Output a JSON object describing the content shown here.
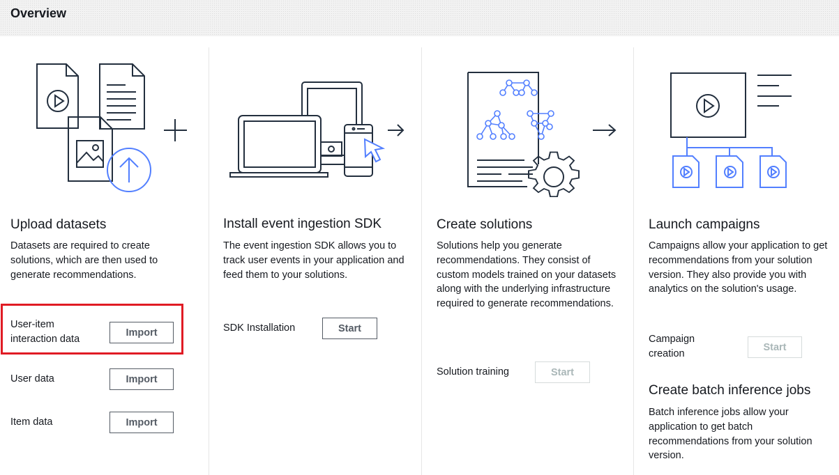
{
  "header": {
    "title": "Overview"
  },
  "columns": {
    "upload": {
      "title": "Upload datasets",
      "description": "Datasets are required to create solutions, which are then used to generate recommendations.",
      "rows": [
        {
          "label": "User-item interaction data",
          "button": "Import"
        },
        {
          "label": "User data",
          "button": "Import"
        },
        {
          "label": "Item data",
          "button": "Import"
        }
      ]
    },
    "sdk": {
      "title": "Install event ingestion SDK",
      "description": "The event ingestion SDK allows you to track user events in your application and feed them to your solutions.",
      "row": {
        "label": "SDK Installation",
        "button": "Start"
      }
    },
    "solutions": {
      "title": "Create solutions",
      "description": "Solutions help you generate recommendations. They consist of custom models trained on your datasets along with the underlying infrastructure required to generate recommendations.",
      "row": {
        "label": "Solution training",
        "button": "Start",
        "disabled": true
      }
    },
    "campaigns": {
      "title": "Launch campaigns",
      "description": "Campaigns allow your application to get recommendations from your solution version. They also provide you with analytics on the solution's usage.",
      "row": {
        "label": "Campaign creation",
        "button": "Start",
        "disabled": true
      },
      "batch": {
        "title": "Create batch inference jobs",
        "description": "Batch inference jobs allow your application to get batch recommendations from your solution version."
      }
    }
  },
  "colors": {
    "ink": "#232f3e",
    "accent": "#527fff",
    "highlight": "#e01b24"
  },
  "icons": [
    "upload-datasets-illustration",
    "sdk-devices-illustration",
    "solutions-illustration",
    "campaigns-illustration"
  ]
}
